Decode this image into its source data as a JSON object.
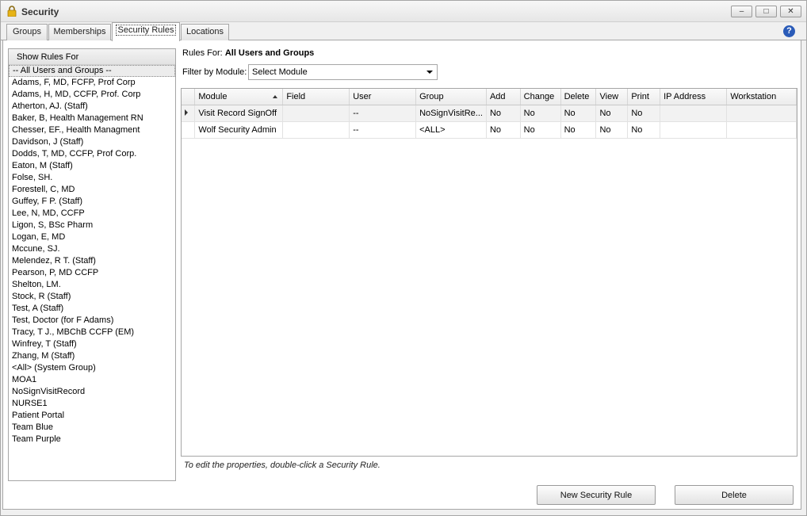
{
  "window": {
    "title": "Security",
    "minimize_glyph": "–",
    "restore_glyph": "□",
    "close_glyph": "✕"
  },
  "tabs": [
    {
      "label": "Groups"
    },
    {
      "label": "Memberships"
    },
    {
      "label": "Security Rules"
    },
    {
      "label": "Locations"
    }
  ],
  "help_glyph": "?",
  "left_panel": {
    "header": "Show Rules For",
    "items": [
      "-- All Users and Groups --",
      "Adams, F, MD, FCFP, Prof Corp",
      "Adams, H, MD, CCFP, Prof. Corp",
      "Atherton, AJ. (Staff)",
      "Baker, B, Health Management RN",
      "Chesser, EF., Health Managment",
      "Davidson, J (Staff)",
      "Dodds, T, MD, CCFP, Prof Corp.",
      "Eaton, M (Staff)",
      "Folse, SH.",
      "Forestell, C, MD",
      "Guffey, F P. (Staff)",
      "Lee, N, MD, CCFP",
      "Ligon, S, BSc Pharm",
      "Logan, E, MD",
      "Mccune, SJ.",
      "Melendez, R T. (Staff)",
      "Pearson, P, MD CCFP",
      "Shelton, LM.",
      "Stock, R (Staff)",
      "Test, A (Staff)",
      "Test, Doctor (for F Adams)",
      "Tracy, T J., MBChB CCFP (EM)",
      "Winfrey, T (Staff)",
      "Zhang, M (Staff)",
      "<All> (System Group)",
      "MOA1",
      "NoSignVisitRecord",
      "NURSE1",
      "Patient Portal",
      "Team Blue",
      "Team Purple"
    ]
  },
  "rules_for": {
    "label": "Rules For:",
    "value": "All Users and Groups"
  },
  "filter": {
    "label": "Filter by Module:",
    "selected": "Select Module"
  },
  "grid": {
    "columns": [
      "Module",
      "Field",
      "User",
      "Group",
      "Add",
      "Change",
      "Delete",
      "View",
      "Print",
      "IP Address",
      "Workstation"
    ],
    "rows": [
      [
        "Visit Record SignOff",
        "",
        "--",
        "NoSignVisitRe...",
        "No",
        "No",
        "No",
        "No",
        "No",
        "",
        ""
      ],
      [
        "Wolf Security Admin",
        "",
        "--",
        "<ALL>",
        "No",
        "No",
        "No",
        "No",
        "No",
        "",
        ""
      ]
    ]
  },
  "hint": "To edit the properties, double-click a Security Rule.",
  "buttons": {
    "new_rule": "New Security Rule",
    "delete": "Delete"
  }
}
